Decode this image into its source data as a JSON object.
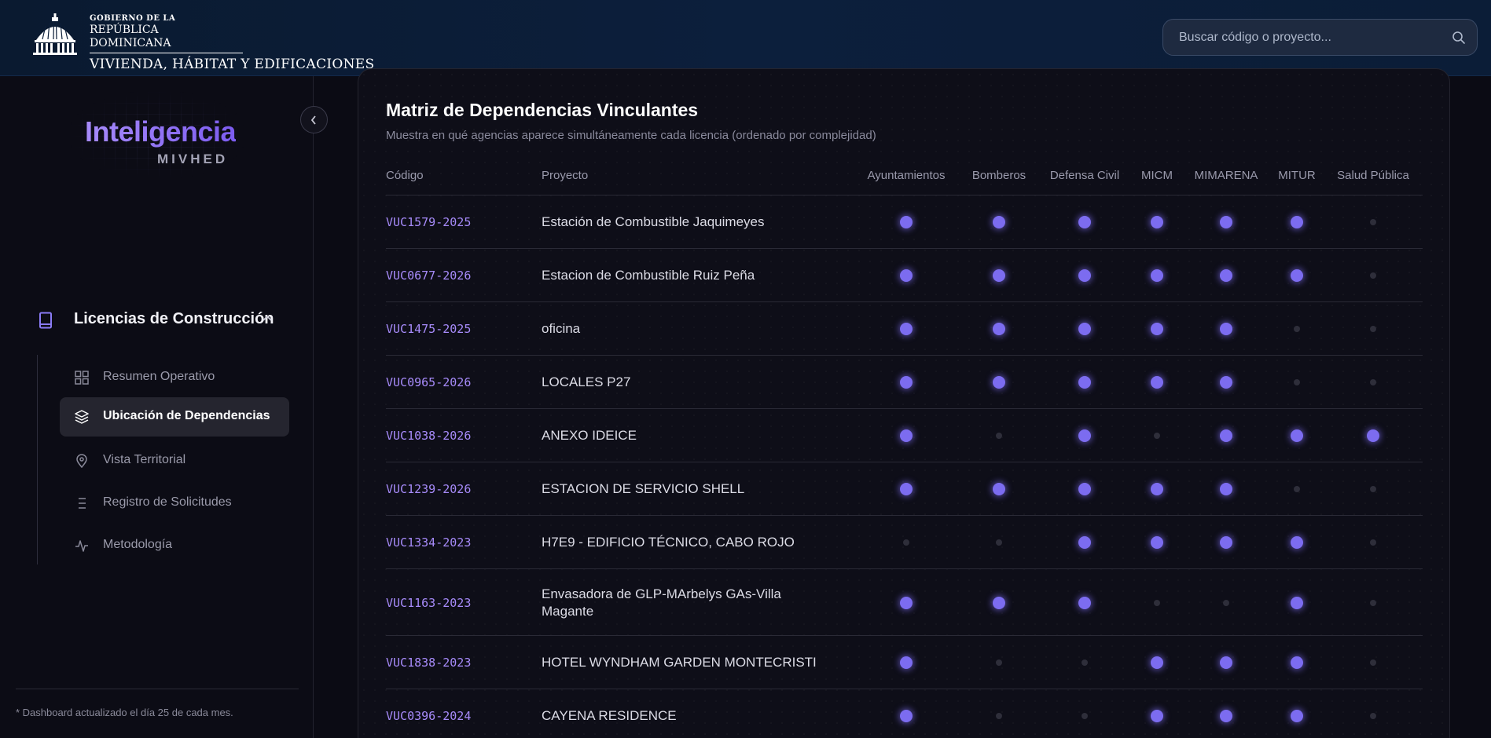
{
  "header": {
    "gov_line1": "GOBIERNO DE LA",
    "gov_line2": "REPÚBLICA DOMINICANA",
    "ministry": "VIVIENDA, HÁBITAT Y EDIFICACIONES",
    "search_placeholder": "Buscar código o proyecto..."
  },
  "brand": {
    "title": "Inteligencia",
    "subtitle": "MIVHED"
  },
  "sidebar": {
    "section_label": "Licencias de Construcción",
    "items": [
      {
        "label": "Resumen Operativo",
        "icon": "grid-icon",
        "active": false
      },
      {
        "label": "Ubicación de Dependencias",
        "icon": "layers-icon",
        "active": true
      },
      {
        "label": "Vista Territorial",
        "icon": "map-pin-icon",
        "active": false
      },
      {
        "label": "Registro de Solicitudes",
        "icon": "list-icon",
        "active": false
      },
      {
        "label": "Metodología",
        "icon": "activity-icon",
        "active": false
      }
    ],
    "footer_note": "* Dashboard actualizado el día 25 de cada mes."
  },
  "matrix": {
    "title": "Matriz de Dependencias Vinculantes",
    "subtitle": "Muestra en qué agencias aparece simultáneamente cada licencia (ordenado por complejidad)",
    "col_code": "Código",
    "col_project": "Proyecto",
    "agencies": [
      "Ayuntamientos",
      "Bomberos",
      "Defensa Civil",
      "MICM",
      "MIMARENA",
      "MITUR",
      "Salud Pública"
    ],
    "rows": [
      {
        "code": "VUC1579-2025",
        "project": "Estación de Combustible Jaquimeyes",
        "flags": [
          1,
          1,
          1,
          1,
          1,
          1,
          0
        ]
      },
      {
        "code": "VUC0677-2026",
        "project": "Estacion de Combustible Ruiz Peña",
        "flags": [
          1,
          1,
          1,
          1,
          1,
          1,
          0
        ]
      },
      {
        "code": "VUC1475-2025",
        "project": "oficina",
        "flags": [
          1,
          1,
          1,
          1,
          1,
          0,
          0
        ]
      },
      {
        "code": "VUC0965-2026",
        "project": "LOCALES P27",
        "flags": [
          1,
          1,
          1,
          1,
          1,
          0,
          0
        ]
      },
      {
        "code": "VUC1038-2026",
        "project": "ANEXO IDEICE",
        "flags": [
          1,
          0,
          1,
          0,
          1,
          1,
          1
        ]
      },
      {
        "code": "VUC1239-2026",
        "project": "ESTACION DE SERVICIO SHELL",
        "flags": [
          1,
          1,
          1,
          1,
          1,
          0,
          0
        ]
      },
      {
        "code": "VUC1334-2023",
        "project": "H7E9 - EDIFICIO TÉCNICO, CABO ROJO",
        "flags": [
          0,
          0,
          1,
          1,
          1,
          1,
          0
        ]
      },
      {
        "code": "VUC1163-2023",
        "project": "Envasadora de GLP-MArbelys GAs-Villa Magante",
        "flags": [
          1,
          1,
          1,
          0,
          0,
          1,
          0
        ]
      },
      {
        "code": "VUC1838-2023",
        "project": "HOTEL WYNDHAM GARDEN MONTECRISTI",
        "flags": [
          1,
          0,
          0,
          1,
          1,
          1,
          0
        ]
      },
      {
        "code": "VUC0396-2024",
        "project": "CAYENA RESIDENCE",
        "flags": [
          1,
          0,
          0,
          1,
          1,
          1,
          0
        ]
      }
    ]
  }
}
